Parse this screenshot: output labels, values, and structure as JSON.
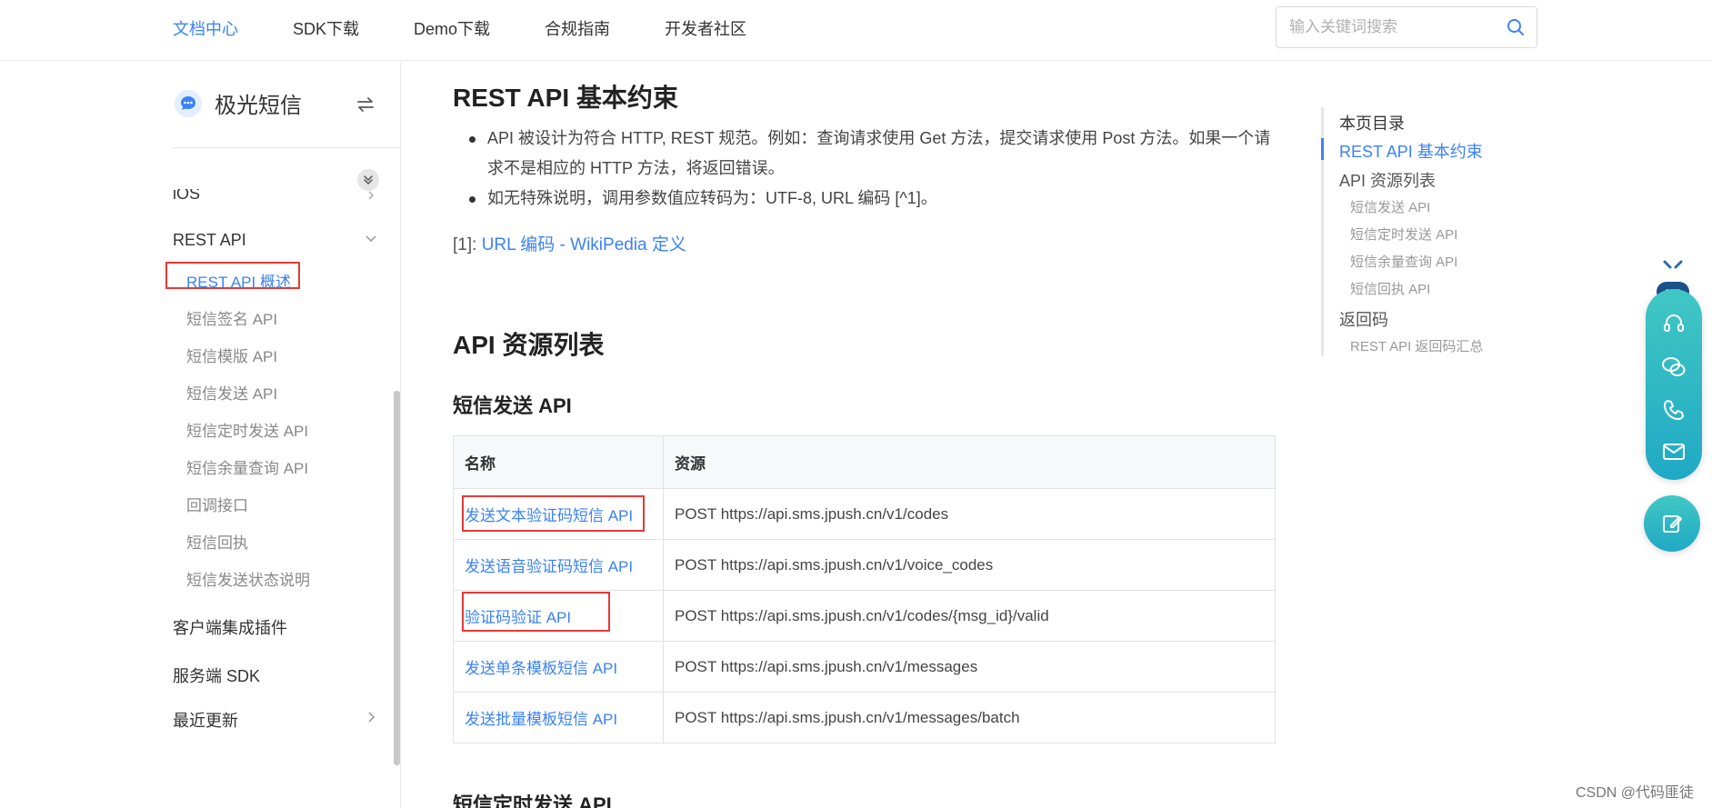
{
  "topnav": {
    "items": [
      "文档中心",
      "SDK下载",
      "Demo下载",
      "合规指南",
      "开发者社区"
    ],
    "search_placeholder": "输入关键词搜索"
  },
  "sidebar": {
    "brand": "极光短信",
    "items": {
      "ios": "iOS",
      "rest_api": "REST API",
      "client_plugins": "客户端集成插件",
      "server_sdk": "服务端 SDK",
      "recent_updates": "最近更新"
    },
    "rest_api_children": [
      "REST API 概述",
      "短信签名 API",
      "短信模版 API",
      "短信发送 API",
      "短信定时发送 API",
      "短信余量查询 API",
      "回调接口",
      "短信回执",
      "短信发送状态说明"
    ]
  },
  "content": {
    "section1_title": "REST API 基本约束",
    "bullets": [
      "API 被设计为符合 HTTP, REST 规范。例如：查询请求使用 Get 方法，提交请求使用 Post 方法。如果一个请求不是相应的 HTTP 方法，将返回错误。",
      "如无特殊说明，调用参数值应转码为：UTF-8, URL 编码 [^1]。"
    ],
    "footnote_prefix": "[1]: ",
    "footnote_link": "URL 编码 - WikiPedia 定义",
    "section2_title": "API 资源列表",
    "subsection_title": "短信发送 API",
    "table": {
      "headers": [
        "名称",
        "资源"
      ],
      "rows": [
        {
          "name": "发送文本验证码短信 API",
          "resource": "POST https://api.sms.jpush.cn/v1/codes"
        },
        {
          "name": "发送语音验证码短信 API",
          "resource": "POST https://api.sms.jpush.cn/v1/voice_codes"
        },
        {
          "name": "验证码验证 API",
          "resource": "POST https://api.sms.jpush.cn/v1/codes/{msg_id}/valid"
        },
        {
          "name": "发送单条模板短信 API",
          "resource": "POST https://api.sms.jpush.cn/v1/messages"
        },
        {
          "name": "发送批量模板短信 API",
          "resource": "POST https://api.sms.jpush.cn/v1/messages/batch"
        }
      ]
    },
    "next_subsection_title": "短信定时发送 API"
  },
  "toc": {
    "title": "本页目录",
    "items": [
      "REST API 基本约束",
      "API 资源列表",
      "短信发送 API",
      "短信定时发送 API",
      "短信余量查询 API",
      "短信回执 API",
      "返回码",
      "REST API 返回码汇总"
    ]
  },
  "watermark": "CSDN @代码匪徒",
  "colors": {
    "accent": "#3b82f6",
    "highlight_box": "#e53935",
    "float_widget": "#2bb8c5"
  },
  "icons": [
    "search-icon",
    "chat-bubble-logo",
    "swap-icon",
    "double-chevron-down-icon",
    "chevron-down-icon",
    "chevron-right-icon",
    "robot-icon",
    "headset-icon",
    "wechat-icon",
    "phone-icon",
    "mail-icon",
    "edit-icon"
  ]
}
